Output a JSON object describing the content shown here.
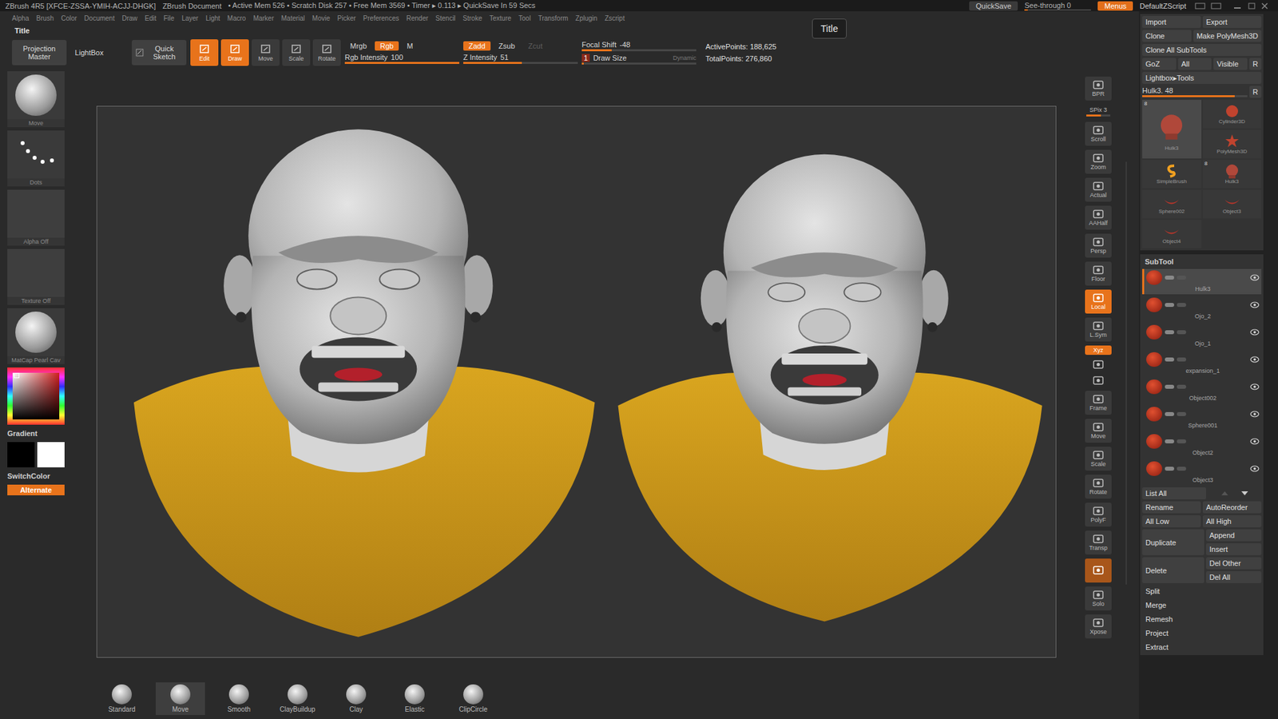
{
  "title_bar": {
    "app": "ZBrush 4R5 [XFCE-ZSSA-YMIH-ACJJ-DHGK]",
    "document": "ZBrush Document",
    "stats": "• Active Mem 526 • Scratch Disk 257 • Free Mem 3569 • Timer ▸ 0.113 ▸ QuickSave In 59 Secs",
    "quicksave": "QuickSave",
    "see_through": {
      "label": "See-through",
      "value": "0",
      "level": 0.05
    },
    "menus": {
      "label": "Menus",
      "on": true
    },
    "script": "DefaultZScript"
  },
  "menu_bar": [
    "Alpha",
    "Brush",
    "Color",
    "Document",
    "Draw",
    "Edit",
    "File",
    "Layer",
    "Light",
    "Macro",
    "Marker",
    "Material",
    "Movie",
    "Picker",
    "Preferences",
    "Render",
    "Stencil",
    "Stroke",
    "Texture",
    "Tool",
    "Transform",
    "Zplugin",
    "Zscript"
  ],
  "palette_title": "Title",
  "tooltip": "Title",
  "toolbar": {
    "panels": [
      {
        "label": "Projection Master",
        "selected": false
      },
      {
        "label": "LightBox",
        "selected": false
      },
      {
        "label": "Quick Sketch",
        "selected": false
      }
    ],
    "modes": [
      {
        "label": "Edit",
        "selected": true
      },
      {
        "label": "Draw",
        "selected": true
      },
      {
        "label": "Move",
        "selected": false
      },
      {
        "label": "Scale",
        "selected": false
      },
      {
        "label": "Rotate",
        "selected": false
      }
    ],
    "groups": [
      {
        "rows": [
          {
            "kind": "buttons",
            "buttons": [
              {
                "label": "Mrgb",
                "selected": false,
                "disabled": false
              },
              {
                "label": "Rgb",
                "selected": true,
                "disabled": false
              },
              {
                "label": "M",
                "selected": false,
                "disabled": false
              }
            ]
          },
          {
            "kind": "slider",
            "label": "Rgb Intensity",
            "value": "100",
            "level": 1,
            "order": "value-after",
            "extra": ""
          }
        ]
      },
      {
        "rows": [
          {
            "kind": "buttons",
            "buttons": [
              {
                "label": "Zadd",
                "selected": true,
                "disabled": false
              },
              {
                "label": "Zsub",
                "selected": false,
                "disabled": false
              },
              {
                "label": "Zcut",
                "selected": false,
                "disabled": true
              }
            ]
          },
          {
            "kind": "slider",
            "label": "Z Intensity",
            "value": "51",
            "level": 0.51,
            "order": "value-after",
            "extra": ""
          }
        ]
      },
      {
        "rows": [
          {
            "kind": "slider",
            "label": "Focal Shift",
            "value": "-48",
            "level": 0.26,
            "order": "value-after",
            "extra": ""
          },
          {
            "kind": "slider",
            "label": "Draw Size",
            "value": "1",
            "level": 0.02,
            "order": "value-first",
            "extra": "Dynamic"
          }
        ]
      }
    ],
    "points": [
      "ActivePoints: 188,625",
      "TotalPoints: 276,860"
    ]
  },
  "left_shelf": {
    "items": [
      {
        "label": "Move",
        "kind": "brush"
      },
      {
        "label": "Dots",
        "kind": "stroke"
      },
      {
        "label": "Alpha Off",
        "kind": "empty"
      },
      {
        "label": "Texture Off",
        "kind": "empty"
      },
      {
        "label": "MatCap Pearl Cav",
        "kind": "material"
      }
    ],
    "gradient": "Gradient",
    "main_color": "#000000",
    "secondary_color": "#ffffff",
    "switch": "SwitchColor",
    "alternate": {
      "label": "Alternate",
      "on": true
    }
  },
  "right_shelf": [
    {
      "label": "BPR",
      "kind": "button",
      "selected": false,
      "level": 0
    },
    {
      "label": "SPix 3",
      "kind": "slider",
      "selected": false,
      "level": 0.6
    },
    {
      "label": "Scroll",
      "kind": "button",
      "selected": false,
      "level": 0
    },
    {
      "label": "Zoom",
      "kind": "button",
      "selected": false,
      "level": 0
    },
    {
      "label": "Actual",
      "kind": "button",
      "selected": false,
      "level": 0
    },
    {
      "label": "AAHalf",
      "kind": "button",
      "selected": false,
      "level": 0
    },
    {
      "label": "Persp",
      "kind": "button",
      "selected": false,
      "level": 0
    },
    {
      "label": "Floor",
      "kind": "button",
      "selected": false,
      "level": 0
    },
    {
      "label": "Local",
      "kind": "button",
      "selected": true,
      "level": 0
    },
    {
      "label": "L.Sym",
      "kind": "button",
      "selected": false,
      "level": 0
    },
    {
      "label": "Xyz",
      "kind": "small",
      "selected": true,
      "level": 0
    },
    {
      "label": "",
      "kind": "icon",
      "selected": false,
      "level": 0
    },
    {
      "label": "",
      "kind": "icon",
      "selected": false,
      "level": 0
    },
    {
      "label": "Frame",
      "kind": "button",
      "selected": false,
      "level": 0
    },
    {
      "label": "Move",
      "kind": "button",
      "selected": false,
      "level": 0
    },
    {
      "label": "Scale",
      "kind": "button",
      "selected": false,
      "level": 0
    },
    {
      "label": "Rotate",
      "kind": "button",
      "selected": false,
      "level": 0
    },
    {
      "label": "PolyF",
      "kind": "button",
      "selected": false,
      "level": 0
    },
    {
      "label": "Transp",
      "kind": "button",
      "selected": false,
      "level": 0
    },
    {
      "label": "",
      "kind": "icon",
      "selected": true,
      "level": 0
    },
    {
      "label": "Solo",
      "kind": "button",
      "selected": false,
      "level": 0
    },
    {
      "label": "Xpose",
      "kind": "button",
      "selected": false,
      "level": 0
    }
  ],
  "bottom_shelf": [
    {
      "label": "Standard",
      "selected": false
    },
    {
      "label": "Move",
      "selected": true
    },
    {
      "label": "Smooth",
      "selected": false
    },
    {
      "label": "ClayBuildup",
      "selected": false
    },
    {
      "label": "Clay",
      "selected": false
    },
    {
      "label": "Elastic",
      "selected": false
    },
    {
      "label": "ClipCircle",
      "selected": false
    }
  ],
  "tool": {
    "rows": [
      [
        "Import",
        "Export"
      ],
      [
        "Clone",
        "Make PolyMesh3D"
      ],
      [
        "Clone All SubTools"
      ],
      [
        "GoZ",
        "All",
        "Visible",
        "R"
      ],
      [
        "Lightbox▸Tools"
      ]
    ],
    "current": {
      "label": "Hulk3. 48",
      "level": 0.88,
      "reset": "R"
    },
    "thumbnails": [
      {
        "label": "Hulk3",
        "count": "8",
        "kind": "head",
        "selected": true
      },
      {
        "label": "Cylinder3D",
        "count": "",
        "kind": "cylinder",
        "selected": false
      },
      {
        "label": "PolyMesh3D",
        "count": "",
        "kind": "star",
        "selected": false
      },
      {
        "label": "SimpleBrush",
        "count": "",
        "kind": "brush",
        "selected": false
      },
      {
        "label": "Hulk3",
        "count": "8",
        "kind": "head",
        "selected": false
      },
      {
        "label": "Sphere002",
        "count": "",
        "kind": "lip",
        "selected": false
      },
      {
        "label": "Object3",
        "count": "",
        "kind": "lip",
        "selected": false
      },
      {
        "label": "Object4",
        "count": "",
        "kind": "lip",
        "selected": false
      }
    ]
  },
  "subtool": {
    "title": "SubTool",
    "items": [
      {
        "name": "Hulk3",
        "selected": true,
        "visible": true
      },
      {
        "name": "Ojo_2",
        "selected": false,
        "visible": true
      },
      {
        "name": "Ojo_1",
        "selected": false,
        "visible": true
      },
      {
        "name": "expansion_1",
        "selected": false,
        "visible": true
      },
      {
        "name": "Object002",
        "selected": false,
        "visible": true
      },
      {
        "name": "Sphere001",
        "selected": false,
        "visible": true
      },
      {
        "name": "Object2",
        "selected": false,
        "visible": true
      },
      {
        "name": "Object3",
        "selected": false,
        "visible": true
      }
    ],
    "list_all": "List All",
    "button_rows": [
      [
        "Rename",
        "AutoReorder"
      ],
      [
        "All Low",
        "All High"
      ]
    ],
    "pairs": [
      {
        "main": "Duplicate",
        "side": [
          "Append",
          "Insert"
        ]
      },
      {
        "main": "Delete",
        "side": [
          "Del Other",
          "Del All"
        ]
      }
    ],
    "actions": [
      "Split",
      "Merge",
      "Remesh",
      "Project",
      "Extract"
    ]
  }
}
